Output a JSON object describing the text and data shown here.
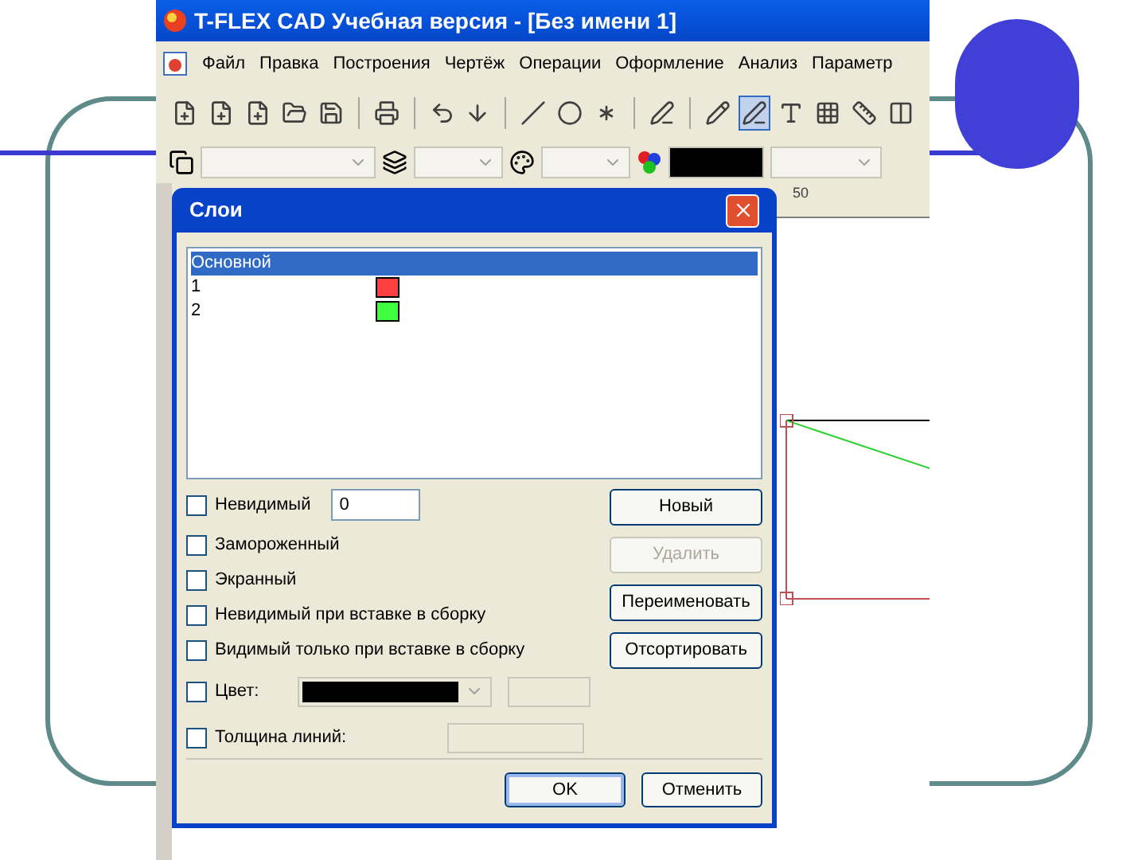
{
  "window": {
    "title": "T-FLEX CAD Учебная версия - [Без имени 1]"
  },
  "menu": [
    {
      "label": "Файл"
    },
    {
      "label": "Правка"
    },
    {
      "label": "Построения"
    },
    {
      "label": "Чертёж"
    },
    {
      "label": "Операции"
    },
    {
      "label": "Оформление"
    },
    {
      "label": "Анализ"
    },
    {
      "label": "Параметр"
    }
  ],
  "ruler": {
    "label": "50"
  },
  "dialog": {
    "title": "Слои",
    "layers": [
      {
        "name": "Основной",
        "selected": true
      },
      {
        "name": "1",
        "color": "#ff4040",
        "selected": false
      },
      {
        "name": "2",
        "color": "#40ff40",
        "selected": false
      }
    ],
    "options": [
      {
        "kind": "field",
        "label": "Невидимый",
        "checked": false,
        "value": "0"
      },
      {
        "kind": "check",
        "label": "Замороженный",
        "checked": false
      },
      {
        "kind": "check",
        "label": "Экранный",
        "checked": false
      },
      {
        "kind": "check",
        "label": "Невидимый при вставке в сборку",
        "checked": false
      },
      {
        "kind": "check",
        "label": "Видимый только при вставке в сборку",
        "checked": false
      },
      {
        "kind": "color",
        "label": "Цвет:",
        "checked": false
      },
      {
        "kind": "spin",
        "label": "Толщина линий:",
        "checked": false
      }
    ],
    "buttons": [
      {
        "label": "Новый",
        "disabled": false
      },
      {
        "label": "Удалить",
        "disabled": true
      },
      {
        "label": "Переименовать",
        "disabled": false
      },
      {
        "label": "Отсортировать",
        "disabled": false
      }
    ],
    "footer_buttons": [
      {
        "label": "OK",
        "default": true
      },
      {
        "label": "Отменить",
        "default": false
      }
    ]
  }
}
